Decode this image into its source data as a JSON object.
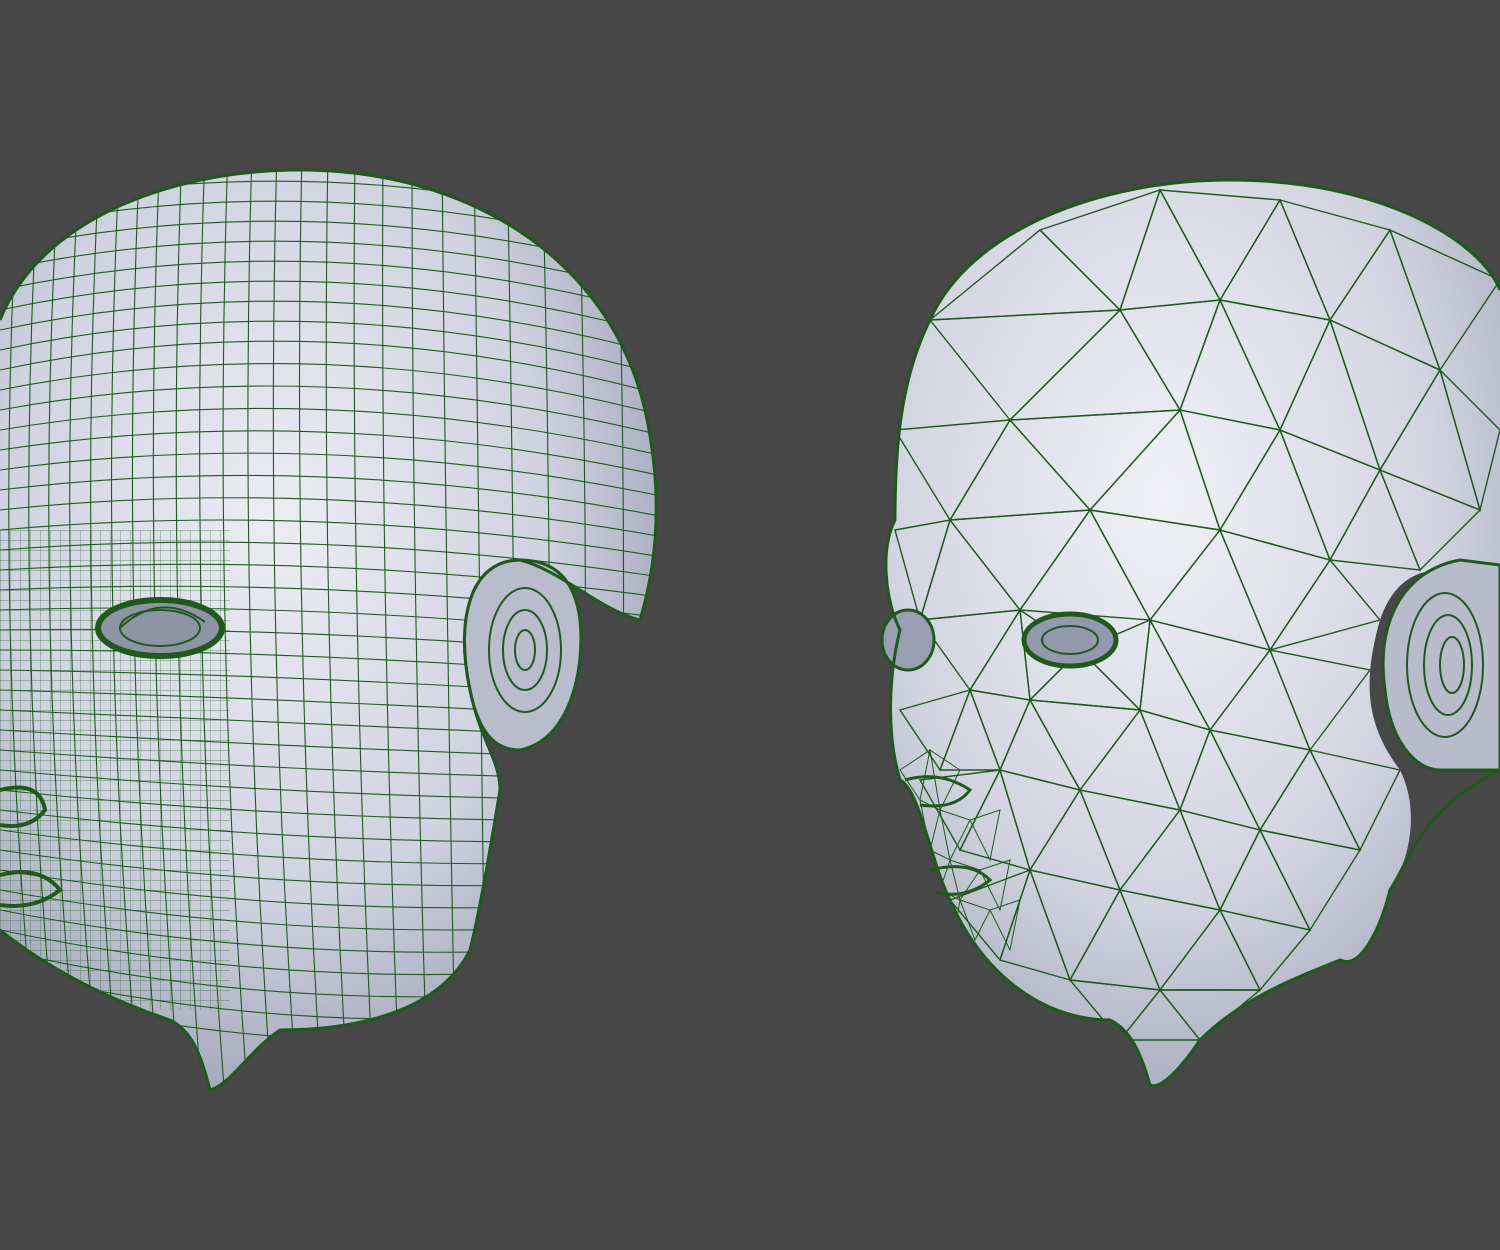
{
  "viewport": {
    "background_color": "#474747"
  },
  "left_model": {
    "topology": "quad",
    "surface_color": "#d2d5e2",
    "wire_color": "#1f5a1c"
  },
  "right_model": {
    "topology": "triangle",
    "surface_color": "#d6d9e4",
    "wire_color": "#1f5a1c"
  }
}
